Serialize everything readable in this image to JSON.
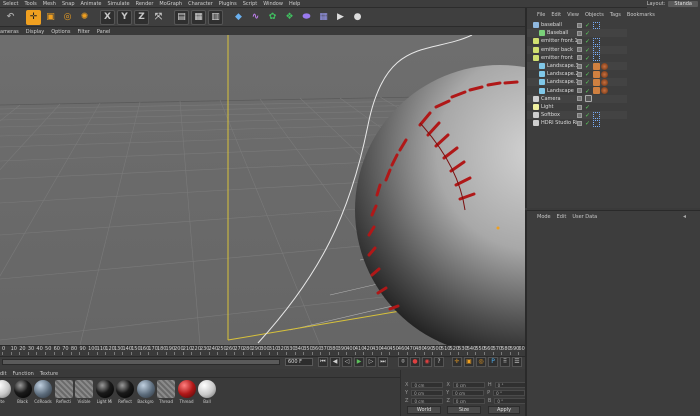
{
  "menubar": {
    "items": [
      "Select",
      "Tools",
      "Mesh",
      "Snap",
      "Animate",
      "Simulate",
      "Render",
      "MoGraph",
      "Character",
      "Plugins",
      "Script",
      "Window",
      "Help"
    ],
    "layout_label": "Layout:",
    "layout_value": "Standa"
  },
  "toolbar": {
    "icons": [
      "undo-icon",
      "move-icon",
      "scale-icon",
      "rotate-icon",
      "x-axis-icon",
      "y-axis-icon",
      "z-axis-icon",
      "coordinate-system-icon",
      "render-view-icon",
      "render-picture-viewer-icon",
      "render-settings-icon",
      "cube-icon",
      "spline-icon",
      "nurbs-icon",
      "array-icon",
      "deformer-icon",
      "scene-icon",
      "camera-icon",
      "light-icon"
    ],
    "axis_labels": [
      "X",
      "Y",
      "Z"
    ]
  },
  "viewport": {
    "menu": [
      "ameras",
      "Display",
      "Options",
      "Filter",
      "Panel"
    ]
  },
  "timeline": {
    "ticks": [
      "0",
      "10",
      "20",
      "30",
      "40",
      "50",
      "60",
      "70",
      "80",
      "90",
      "100",
      "110",
      "120",
      "130",
      "140",
      "150",
      "160",
      "170",
      "180",
      "190",
      "200",
      "210",
      "220",
      "230",
      "240",
      "250",
      "260",
      "270",
      "280",
      "290",
      "300",
      "310",
      "320",
      "330",
      "340",
      "350",
      "360",
      "370",
      "380",
      "390",
      "400",
      "410",
      "420",
      "430",
      "440",
      "450",
      "460",
      "470",
      "480",
      "490",
      "500",
      "510",
      "520",
      "530",
      "540",
      "550",
      "560",
      "570",
      "580",
      "590",
      "600"
    ],
    "end_frame": "600 F",
    "current_frame": "0 F"
  },
  "materials": {
    "menu": [
      "dit",
      "Function",
      "Texture"
    ],
    "items": [
      {
        "label": "ite",
        "kind": "white"
      },
      {
        "label": "Black",
        "kind": "black"
      },
      {
        "label": "CdRoads",
        "kind": "steel"
      },
      {
        "label": "Reflecti",
        "kind": "hatch"
      },
      {
        "label": "Visible",
        "kind": "hatch"
      },
      {
        "label": "Light Mi",
        "kind": "black"
      },
      {
        "label": "Reflect",
        "kind": "black"
      },
      {
        "label": "Backgro",
        "kind": "steel"
      },
      {
        "label": "Thread",
        "kind": "hatch"
      },
      {
        "label": "Thread",
        "kind": "red"
      },
      {
        "label": "Ball",
        "kind": "white"
      }
    ]
  },
  "coordinates": {
    "rows": [
      {
        "axis": "X",
        "a": "0 cm",
        "b": "X",
        "c": "0 cm",
        "d": "H",
        "e": "0 °"
      },
      {
        "axis": "Y",
        "a": "0 cm",
        "b": "Y",
        "c": "0 cm",
        "d": "P",
        "e": "0 °"
      },
      {
        "axis": "Z",
        "a": "0 cm",
        "b": "Z",
        "c": "0 cm",
        "d": "B",
        "e": "0 °"
      }
    ],
    "mode_label": "World",
    "size_label": "Size",
    "apply_label": "Apply"
  },
  "objects": {
    "menu": [
      "File",
      "Edit",
      "View",
      "Objects",
      "Tags",
      "Bookmarks"
    ],
    "rows": [
      {
        "label": "baseball",
        "indent": 0,
        "icon_color": "#8fb8e0"
      },
      {
        "label": "Baseball",
        "indent": 1,
        "icon_color": "#7ad07a"
      },
      {
        "label": "emitter front.1",
        "indent": 0,
        "icon_color": "#d0e070"
      },
      {
        "label": "emitter back",
        "indent": 0,
        "icon_color": "#d0e070"
      },
      {
        "label": "emitter front",
        "indent": 0,
        "icon_color": "#d0e070"
      },
      {
        "label": "Landscape.3",
        "indent": 1,
        "icon_color": "#80c8e8"
      },
      {
        "label": "Landscape.2",
        "indent": 1,
        "icon_color": "#80c8e8"
      },
      {
        "label": "Landscape.1",
        "indent": 1,
        "icon_color": "#80c8e8"
      },
      {
        "label": "Landscape",
        "indent": 1,
        "icon_color": "#80c8e8"
      },
      {
        "label": "Camera",
        "indent": 0,
        "icon_color": "#cfcfcf"
      },
      {
        "label": "Light",
        "indent": 0,
        "icon_color": "#f0f0a0"
      },
      {
        "label": "Softbox",
        "indent": 0,
        "icon_color": "#cfcfcf"
      },
      {
        "label": "HDRI Studio Rig",
        "indent": 0,
        "icon_color": "#cfcfcf"
      }
    ]
  },
  "attributes": {
    "menu": [
      "Mode",
      "Edit",
      "User Data"
    ]
  },
  "colors": {
    "accent": "#f0a020",
    "viewport_bg": "#6c6c6c",
    "seam_red": "#b01818"
  }
}
